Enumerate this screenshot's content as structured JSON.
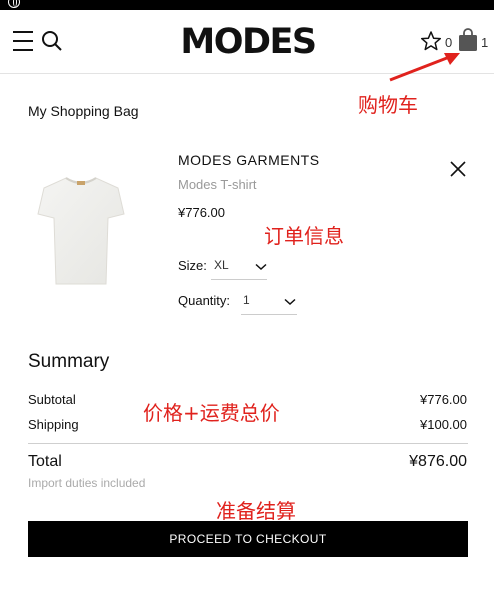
{
  "header": {
    "logo_text": "MODES",
    "wishlist_count": "0",
    "bag_count": "1"
  },
  "annotations": {
    "cart": "购物车",
    "order_info": "订单信息",
    "price_shipping": "价格+运费总价",
    "prepare_checkout": "准备结算",
    "color": "#e0221d"
  },
  "bag": {
    "title": "My Shopping Bag",
    "item": {
      "brand": "MODES GARMENTS",
      "name": "Modes T-shirt",
      "price": "¥776.00",
      "size_label": "Size:",
      "size_value": "XL",
      "quantity_label": "Quantity:",
      "quantity_value": "1"
    }
  },
  "summary": {
    "title": "Summary",
    "subtotal_label": "Subtotal",
    "subtotal_value": "¥776.00",
    "shipping_label": "Shipping",
    "shipping_value": "¥100.00",
    "total_label": "Total",
    "total_value": "¥876.00",
    "duties_note": "Import duties included"
  },
  "checkout": {
    "label": "PROCEED TO CHECKOUT"
  },
  "icons": {
    "menu": "menu-icon",
    "search": "search-icon",
    "wishlist": "star-icon",
    "bag": "shopping-bag-icon",
    "remove": "close-icon",
    "dropdown": "chevron-down-icon"
  }
}
